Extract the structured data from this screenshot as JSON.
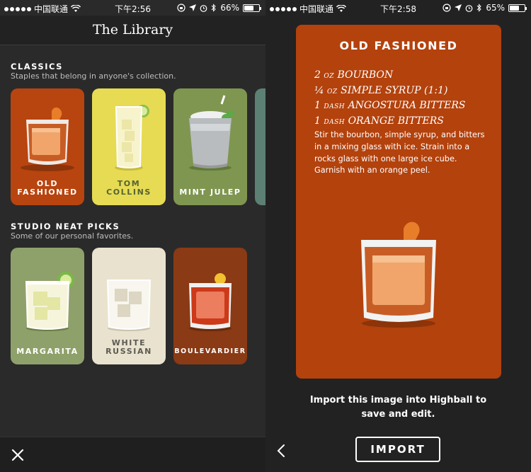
{
  "left_screen": {
    "status": {
      "carrier": "中国联通",
      "time": "下午2:56",
      "battery": "66%",
      "battery_level": 0.66
    },
    "title": "The Library",
    "sections": [
      {
        "title": "CLASSICS",
        "subtitle": "Staples that belong in anyone's collection.",
        "cards": [
          {
            "label1": "OLD",
            "label2": "FASHIONED"
          },
          {
            "label1": "TOM",
            "label2": "COLLINS"
          },
          {
            "label1": "",
            "label2": "MINT JULEP"
          }
        ]
      },
      {
        "title": "STUDIO NEAT PICKS",
        "subtitle": "Some of our personal favorites.",
        "cards": [
          {
            "label1": "",
            "label2": "MARGARITA"
          },
          {
            "label1": "WHITE",
            "label2": "RUSSIAN"
          },
          {
            "label1": "",
            "label2": "BOULEVARDIER"
          }
        ]
      }
    ]
  },
  "right_screen": {
    "status": {
      "carrier": "中国联通",
      "time": "下午2:58",
      "battery": "65%",
      "battery_level": 0.65
    },
    "recipe": {
      "title": "OLD FASHIONED",
      "ingredients": [
        {
          "qty": "2",
          "unit": "OZ",
          "name": "BOURBON"
        },
        {
          "qty": "¼",
          "unit": "OZ",
          "name": "SIMPLE SYRUP (1:1)"
        },
        {
          "qty": "1",
          "unit": "DASH",
          "name": "ANGOSTURA BITTERS"
        },
        {
          "qty": "1",
          "unit": "DASH",
          "name": "ORANGE BITTERS"
        }
      ],
      "instructions": "Stir the bourbon, simple syrup, and bitters in a mixing glass with ice. Strain into a rocks glass with one large ice cube. Garnish with an orange peel."
    },
    "import_message": "Import this image into Highball to save and edit.",
    "import_label": "IMPORT"
  },
  "colors": {
    "old_fashioned": "#b8440f",
    "tom_collins": "#e6db53",
    "mint_julep": "#7f9650",
    "margarita": "#8fa16a",
    "white_russian": "#e8e2cf",
    "boulevardier": "#8a3a14",
    "fifth_card": "#5c8074"
  },
  "icons": [
    "wifi-icon",
    "lock-rotation-icon",
    "location-arrow-icon",
    "alarm-icon",
    "bluetooth-icon",
    "close-icon",
    "back-chevron-icon"
  ]
}
